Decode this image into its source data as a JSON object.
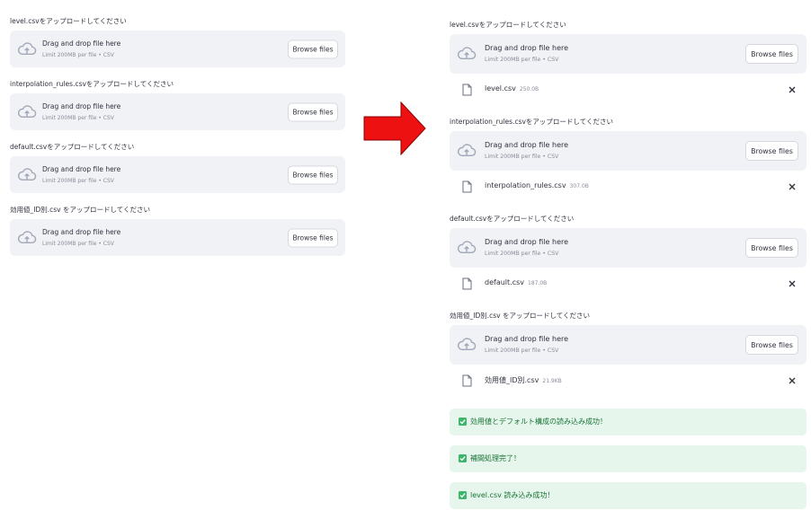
{
  "dropzone": {
    "title": "Drag and drop file here",
    "limit": "Limit 200MB per file • CSV",
    "browse_label": "Browse files"
  },
  "uploaders": [
    {
      "label": "level.csvをアップロードしてください",
      "file_name": "level.csv",
      "file_size": "250.0B"
    },
    {
      "label": "interpolation_rules.csvをアップロードしてください",
      "file_name": "interpolation_rules.csv",
      "file_size": "307.0B"
    },
    {
      "label": "default.csvをアップロードしてください",
      "file_name": "default.csv",
      "file_size": "187.0B"
    },
    {
      "label": "効用値_ID別.csv をアップロードしてください",
      "file_name": "効用値_ID別.csv",
      "file_size": "21.9KB"
    }
  ],
  "alerts": [
    "効用値とデフォルト構成の読み込み成功！",
    "補間処理完了！",
    "level.csv 読み込み成功！"
  ],
  "colors": {
    "arrow": "#ee1111",
    "success_bg": "#e6f6ec",
    "success_text": "#177233",
    "dropzone_bg": "#f0f2f6"
  },
  "icons": [
    "cloud-upload-icon",
    "file-icon",
    "close-icon",
    "check-box-icon",
    "right-arrow-icon"
  ]
}
